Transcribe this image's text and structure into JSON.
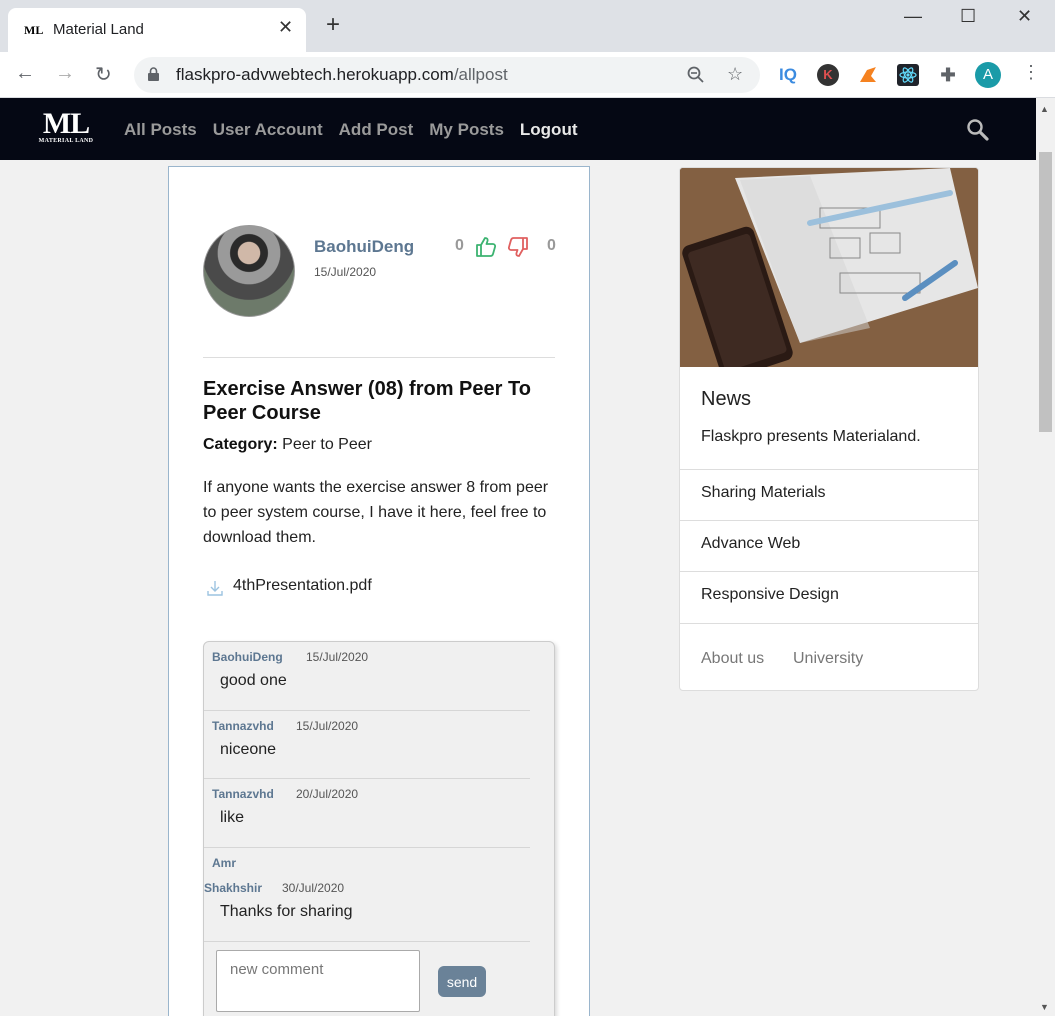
{
  "browser": {
    "tab_title": "Material Land",
    "tab_favicon": "ML",
    "url_host": "flaskpro-advwebtech.herokuapp.com",
    "url_path": "/allpost",
    "profile_initial": "A",
    "ext_iq": "IQ",
    "ext_k": "K"
  },
  "navbar": {
    "logo_big": "ML",
    "logo_small": "MATERIAL LAND",
    "links": [
      "All Posts",
      "User Account",
      "Add Post",
      "My Posts",
      "Logout"
    ]
  },
  "post": {
    "author": "BaohuiDeng",
    "date": "15/Jul/2020",
    "likes": "0",
    "dislikes": "0",
    "title": "Exercise Answer (08) from Peer To Peer Course",
    "category_label": "Category:",
    "category_value": "Peer to Peer",
    "body": "If anyone wants the exercise answer 8 from peer to peer system course, I have it here, feel free to download them.",
    "attachment": "4thPresentation.pdf"
  },
  "comments": [
    {
      "author": "BaohuiDeng",
      "date": "15/Jul/2020",
      "text": "good one"
    },
    {
      "author": "Tannazvhd",
      "date": "15/Jul/2020",
      "text": "niceone"
    },
    {
      "author": "Tannazvhd",
      "date": "20/Jul/2020",
      "text": "like"
    },
    {
      "author_line1": "Amr",
      "author_line2": "Shakhshir",
      "date": "30/Jul/2020",
      "text": "Thanks for sharing"
    }
  ],
  "comment_form": {
    "placeholder": "new comment",
    "send_label": "send"
  },
  "sidebar": {
    "heading": "News",
    "text": "Flaskpro presents Materialand.",
    "items": [
      "Sharing Materials",
      "Advance Web",
      "Responsive Design"
    ],
    "footer_links": [
      "About us",
      "University"
    ]
  },
  "colors": {
    "navbar_bg": "#050814",
    "accent": "#5d7791",
    "like": "#3cb371",
    "dislike": "#e06060",
    "send_button": "#6a8298"
  }
}
